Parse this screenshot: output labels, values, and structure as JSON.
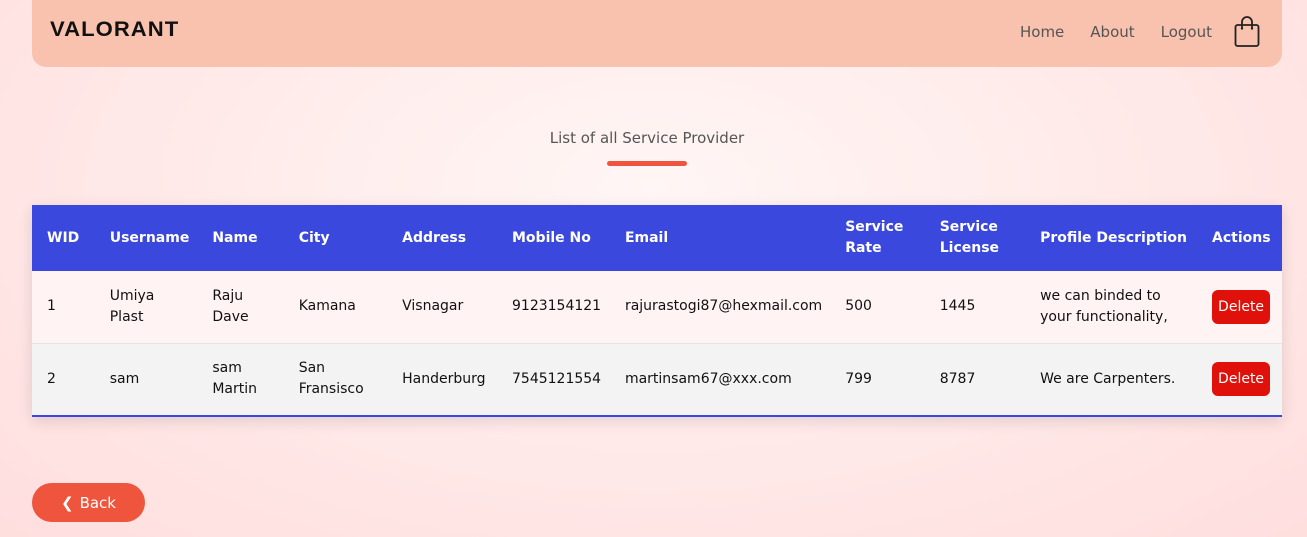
{
  "header": {
    "logo": "VALORANT",
    "nav": [
      "Home",
      "About",
      "Logout"
    ],
    "cart_icon": "shopping-bag-icon"
  },
  "page": {
    "title": "List of all Service Provider"
  },
  "table": {
    "columns": [
      "WID",
      "Username",
      "Name",
      "City",
      "Address",
      "Mobile No",
      "Email",
      "Service Rate",
      "Service License",
      "Profile Description",
      "Actions"
    ],
    "rows": [
      {
        "wid": "1",
        "username": "Umiya Plast",
        "name": "Raju Dave",
        "city": "Kamana",
        "address": "Visnagar",
        "mobile": "9123154121",
        "email": "rajurastogi87@hexmail.com",
        "rate": "500",
        "license": "1445",
        "description": "we can binded to your functionality,",
        "action": "Delete"
      },
      {
        "wid": "2",
        "username": "sam",
        "name": "sam Martin",
        "city": "San Fransisco",
        "address": "Handerburg",
        "mobile": "7545121554",
        "email": "martinsam67@xxx.com",
        "rate": "799",
        "license": "8787",
        "description": "We are Carpenters.",
        "action": "Delete"
      }
    ]
  },
  "footer": {
    "back_arrow": "❮",
    "back_label": "Back"
  },
  "colors": {
    "navbar": "#f8c2ae",
    "table_header": "#3b48dd",
    "accent": "#ef553c",
    "delete": "#e0100a"
  }
}
